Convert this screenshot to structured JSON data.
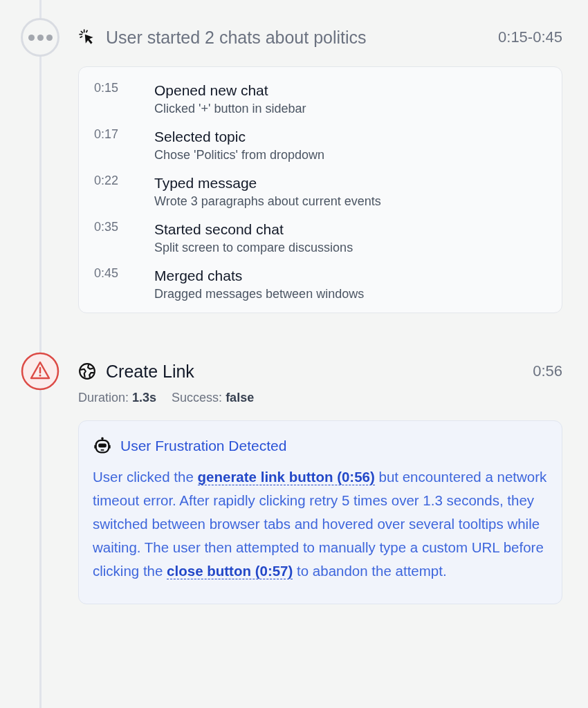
{
  "events": [
    {
      "kind": "group",
      "title": "User started 2 chats about politics",
      "time": "0:15-0:45",
      "steps": [
        {
          "time": "0:15",
          "title": "Opened new chat",
          "detail": "Clicked '+' button in sidebar"
        },
        {
          "time": "0:17",
          "title": "Selected topic",
          "detail": "Chose 'Politics' from dropdown"
        },
        {
          "time": "0:22",
          "title": "Typed message",
          "detail": "Wrote 3 paragraphs about current events"
        },
        {
          "time": "0:35",
          "title": "Started second chat",
          "detail": "Split screen to compare discussions"
        },
        {
          "time": "0:45",
          "title": "Merged chats",
          "detail": "Dragged messages between windows"
        }
      ]
    },
    {
      "kind": "error",
      "title": "Create Link",
      "time": "0:56",
      "meta": [
        {
          "label": "Duration:",
          "value": "1.3s"
        },
        {
          "label": "Success:",
          "value": "false"
        }
      ],
      "insight": {
        "title": "User Frustration Detected",
        "segments": [
          {
            "kind": "text",
            "text": "User clicked the "
          },
          {
            "kind": "link",
            "text": "generate link button (0:56)"
          },
          {
            "kind": "text",
            "text": " but encountered a network timeout error. After rapidly clicking retry 5 times over 1.3 seconds, they switched between browser tabs and hovered over several tooltips while waiting. The user then attempted to manually type a custom URL before clicking the "
          },
          {
            "kind": "link",
            "text": "close button (0:57)"
          },
          {
            "kind": "text",
            "text": " to abandon the attempt."
          }
        ]
      }
    }
  ]
}
